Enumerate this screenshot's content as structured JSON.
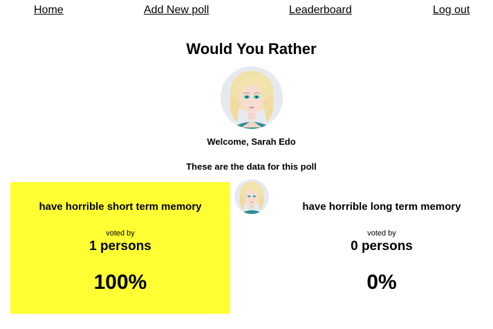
{
  "nav": {
    "home": "Home",
    "add_poll": "Add New poll",
    "leaderboard": "Leaderboard",
    "logout": "Log out"
  },
  "page_title": "Would You Rather",
  "welcome": "Welcome, Sarah Edo",
  "results_heading": "These are the data for this poll",
  "options": [
    {
      "text": "have horrible short term memory",
      "voted_by_label": "voted by",
      "count_label": "1 persons",
      "percent_label": "100%",
      "highlighted": true,
      "highlight_color": "#ffff33"
    },
    {
      "text": "have horrible long term memory",
      "voted_by_label": "voted by",
      "count_label": "0 persons",
      "percent_label": "0%",
      "highlighted": false
    }
  ],
  "icons": {
    "user_avatar": "user-avatar-icon",
    "author_avatar": "author-avatar-icon"
  }
}
